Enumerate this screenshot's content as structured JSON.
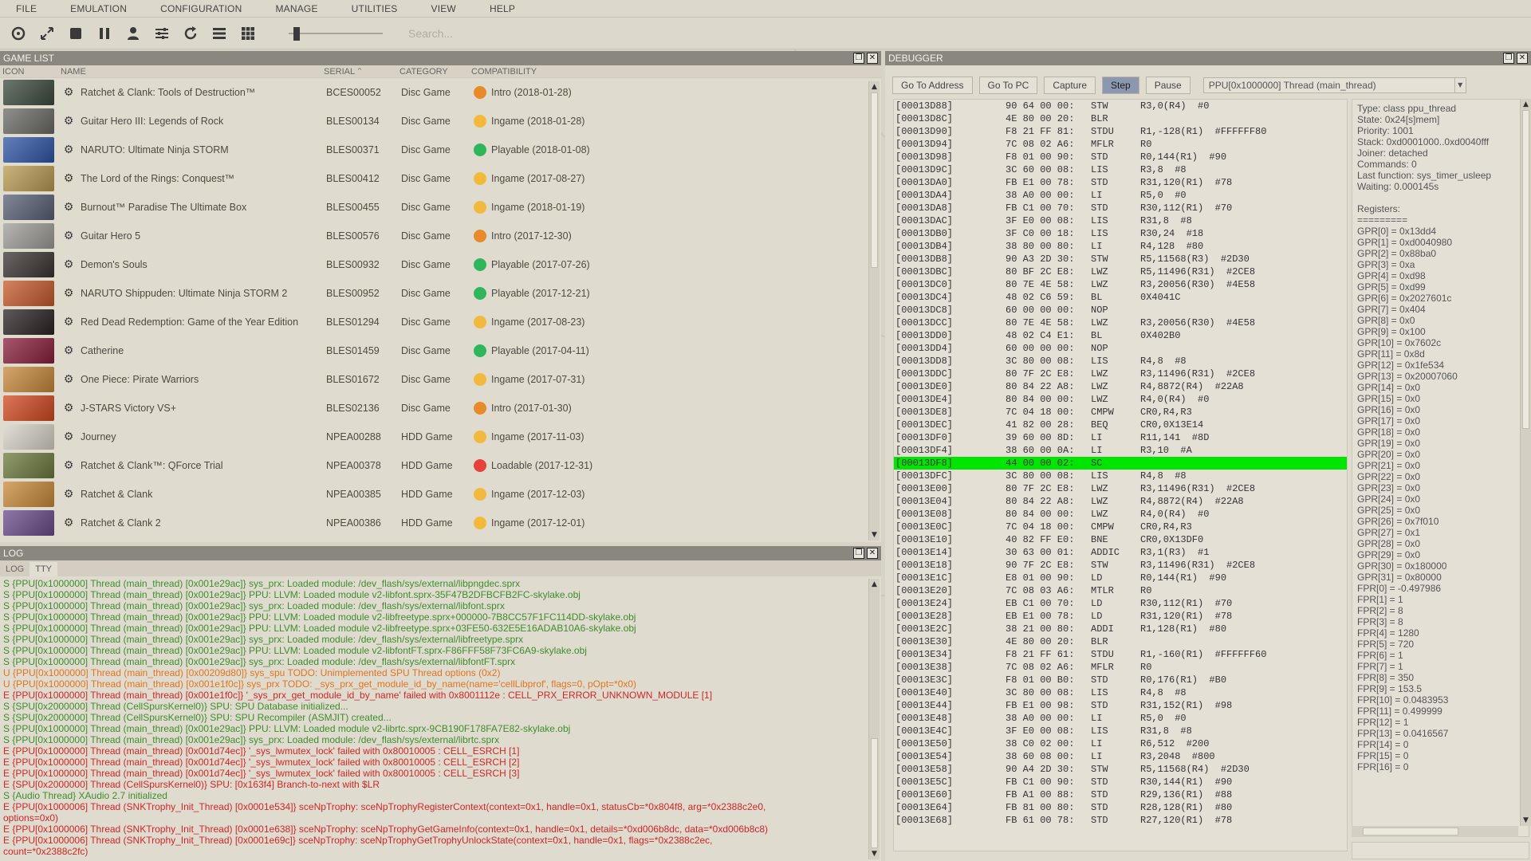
{
  "menu": [
    "FILE",
    "EMULATION",
    "CONFIGURATION",
    "MANAGE",
    "UTILITIES",
    "VIEW",
    "HELP"
  ],
  "toolbar": {
    "icons": [
      "disc-icon",
      "fullscreen-icon",
      "stop-icon",
      "pause-icon",
      "user-icon",
      "config-icon",
      "refresh-icon",
      "list-view-icon",
      "grid-view-icon"
    ],
    "search_placeholder": "Search..."
  },
  "game_list": {
    "title": "GAME LIST",
    "columns": [
      "ICON",
      "NAME",
      "SERIAL",
      "CATEGORY",
      "COMPATIBILITY"
    ],
    "rows": [
      {
        "name": "Ratchet & Clank: Tools of Destruction™",
        "serial": "BCES00052",
        "category": "Disc Game",
        "compat": "Intro (2018-01-28)",
        "color": "#e98a2a",
        "cover": "#3b4a3e"
      },
      {
        "name": "Guitar Hero III: Legends of Rock",
        "serial": "BLES00134",
        "category": "Disc Game",
        "compat": "Ingame (2018-01-28)",
        "color": "#f3b93a",
        "cover": "#6a6a66"
      },
      {
        "name": "NARUTO: Ultimate Ninja STORM",
        "serial": "BLES00371",
        "category": "Disc Game",
        "compat": "Playable (2018-01-08)",
        "color": "#2fb55a",
        "cover": "#2f56a6"
      },
      {
        "name": "The Lord of the Rings: Conquest™",
        "serial": "BLES00412",
        "category": "Disc Game",
        "compat": "Ingame (2017-08-27)",
        "color": "#f3b93a",
        "cover": "#b99a52"
      },
      {
        "name": "Burnout™ Paradise The Ultimate Box",
        "serial": "BLES00455",
        "category": "Disc Game",
        "compat": "Ingame (2018-01-19)",
        "color": "#f3b93a",
        "cover": "#586074"
      },
      {
        "name": "Guitar Hero 5",
        "serial": "BLES00576",
        "category": "Disc Game",
        "compat": "Intro (2017-12-30)",
        "color": "#e98a2a",
        "cover": "#9e9d98"
      },
      {
        "name": "Demon's Souls",
        "serial": "BLES00932",
        "category": "Disc Game",
        "compat": "Playable (2017-07-26)",
        "color": "#2fb55a",
        "cover": "#3a3430"
      },
      {
        "name": "NARUTO Shippuden: Ultimate Ninja STORM 2",
        "serial": "BLES00952",
        "category": "Disc Game",
        "compat": "Playable (2017-12-21)",
        "color": "#2fb55a",
        "cover": "#c45a2a"
      },
      {
        "name": "Red Dead Redemption: Game of the Year Edition",
        "serial": "BLES01294",
        "category": "Disc Game",
        "compat": "Ingame (2017-08-23)",
        "color": "#f3b93a",
        "cover": "#2a2222"
      },
      {
        "name": "Catherine",
        "serial": "BLES01459",
        "category": "Disc Game",
        "compat": "Playable (2017-04-11)",
        "color": "#2fb55a",
        "cover": "#8a1f3a"
      },
      {
        "name": "One Piece: Pirate Warriors",
        "serial": "BLES01672",
        "category": "Disc Game",
        "compat": "Ingame (2017-07-31)",
        "color": "#f3b93a",
        "cover": "#c8893a"
      },
      {
        "name": "J-STARS Victory VS+",
        "serial": "BLES02136",
        "category": "Disc Game",
        "compat": "Intro (2017-01-30)",
        "color": "#e98a2a",
        "cover": "#d04a20"
      },
      {
        "name": "Journey",
        "serial": "NPEA00288",
        "category": "HDD Game",
        "compat": "Ingame (2017-11-03)",
        "color": "#f3b93a",
        "cover": "#d8d4c8"
      },
      {
        "name": "Ratchet & Clank™: QForce Trial",
        "serial": "NPEA00378",
        "category": "HDD Game",
        "compat": "Loadable (2017-12-31)",
        "color": "#e5433a",
        "cover": "#6c7a3c"
      },
      {
        "name": "Ratchet & Clank",
        "serial": "NPEA00385",
        "category": "HDD Game",
        "compat": "Ingame (2017-12-03)",
        "color": "#f3b93a",
        "cover": "#c88a3a"
      },
      {
        "name": "Ratchet & Clank 2",
        "serial": "NPEA00386",
        "category": "HDD Game",
        "compat": "Ingame (2017-12-01)",
        "color": "#f3b93a",
        "cover": "#6a4a8a"
      }
    ]
  },
  "log": {
    "title": "LOG",
    "tabs": [
      "LOG",
      "TTY"
    ],
    "lines": [
      {
        "t": "S {PPU[0x1000000] Thread (main_thread) [0x001e29ac]} sys_prx: Loaded module: /dev_flash/sys/external/libpngdec.sprx",
        "c": "green"
      },
      {
        "t": "S {PPU[0x1000000] Thread (main_thread) [0x001e29ac]} PPU: LLVM: Loaded module v2-libfont.sprx-35F47B2DFBCFB2FC-skylake.obj",
        "c": "green"
      },
      {
        "t": "S {PPU[0x1000000] Thread (main_thread) [0x001e29ac]} sys_prx: Loaded module: /dev_flash/sys/external/libfont.sprx",
        "c": "green"
      },
      {
        "t": "S {PPU[0x1000000] Thread (main_thread) [0x001e29ac]} PPU: LLVM: Loaded module v2-libfreetype.sprx+000000-7B8CC57F1FC114DD-skylake.obj",
        "c": "green"
      },
      {
        "t": "S {PPU[0x1000000] Thread (main_thread) [0x001e29ac]} PPU: LLVM: Loaded module v2-libfreetype.sprx+03FE50-632E5E16ADAB10A6-skylake.obj",
        "c": "green"
      },
      {
        "t": "S {PPU[0x1000000] Thread (main_thread) [0x001e29ac]} sys_prx: Loaded module: /dev_flash/sys/external/libfreetype.sprx",
        "c": "green"
      },
      {
        "t": "S {PPU[0x1000000] Thread (main_thread) [0x001e29ac]} PPU: LLVM: Loaded module v2-libfontFT.sprx-F86FFF58F73FC6A9-skylake.obj",
        "c": "green"
      },
      {
        "t": "S {PPU[0x1000000] Thread (main_thread) [0x001e29ac]} sys_prx: Loaded module: /dev_flash/sys/external/libfontFT.sprx",
        "c": "green"
      },
      {
        "t": "U {PPU[0x1000000] Thread (main_thread) [0x00209d80]} sys_spu TODO: Unimplemented SPU Thread options (0x2)",
        "c": "orange"
      },
      {
        "t": "U {PPU[0x1000000] Thread (main_thread) [0x001e1f0c]} sys_prx TODO: _sys_prx_get_module_id_by_name(name='cellLibprof', flags=0, pOpt=*0x0)",
        "c": "orange"
      },
      {
        "t": "E {PPU[0x1000000] Thread (main_thread) [0x001e1f0c]} '_sys_prx_get_module_id_by_name' failed with 0x8001112e : CELL_PRX_ERROR_UNKNOWN_MODULE [1]",
        "c": "red"
      },
      {
        "t": "S {SPU[0x2000000] Thread (CellSpursKernel0)} SPU: SPU Database initialized...",
        "c": "green"
      },
      {
        "t": "S {SPU[0x2000000] Thread (CellSpursKernel0)} SPU: SPU Recompiler (ASMJIT) created...",
        "c": "green"
      },
      {
        "t": "S {PPU[0x1000000] Thread (main_thread) [0x001e29ac]} PPU: LLVM: Loaded module v2-librtc.sprx-9CB190F178FA7E82-skylake.obj",
        "c": "green"
      },
      {
        "t": "S {PPU[0x1000000] Thread (main_thread) [0x001e29ac]} sys_prx: Loaded module: /dev_flash/sys/external/librtc.sprx",
        "c": "green"
      },
      {
        "t": "E {PPU[0x1000000] Thread (main_thread) [0x001d74ec]} '_sys_lwmutex_lock' failed with 0x80010005 : CELL_ESRCH [1]",
        "c": "red"
      },
      {
        "t": "E {PPU[0x1000000] Thread (main_thread) [0x001d74ec]} '_sys_lwmutex_lock' failed with 0x80010005 : CELL_ESRCH [2]",
        "c": "red"
      },
      {
        "t": "E {PPU[0x1000000] Thread (main_thread) [0x001d74ec]} '_sys_lwmutex_lock' failed with 0x80010005 : CELL_ESRCH [3]",
        "c": "red"
      },
      {
        "t": "E {SPU[0x2000000] Thread (CellSpursKernel0)} SPU: [0x163f4] Branch-to-next with $LR",
        "c": "red"
      },
      {
        "t": "S {Audio Thread} XAudio 2.7 initialized",
        "c": "green"
      },
      {
        "t": "E {PPU[0x1000006] Thread (SNKTrophy_Init_Thread) [0x0001e534]} sceNpTrophy: sceNpTrophyRegisterContext(context=0x1, handle=0x1, statusCb=*0x804f8, arg=*0x2388c2e0,",
        "c": "red"
      },
      {
        "t": "options=0x0)",
        "c": "red"
      },
      {
        "t": "E {PPU[0x1000006] Thread (SNKTrophy_Init_Thread) [0x0001e638]} sceNpTrophy: sceNpTrophyGetGameInfo(context=0x1, handle=0x1, details=*0xd006b8dc, data=*0xd006b8c8)",
        "c": "red"
      },
      {
        "t": "E {PPU[0x1000006] Thread (SNKTrophy_Init_Thread) [0x0001e69c]} sceNpTrophy: sceNpTrophyGetTrophyUnlockState(context=0x1, handle=0x1, flags=*0x2388c2ec,",
        "c": "red"
      },
      {
        "t": "count=*0x2388c2fc)",
        "c": "red"
      }
    ]
  },
  "debugger": {
    "title": "DEBUGGER",
    "buttons": [
      "Go To Address",
      "Go To PC",
      "Capture",
      "Step",
      "Pause"
    ],
    "active_button": "Step",
    "thread": "PPU[0x1000000] Thread (main_thread)",
    "disasm": [
      [
        "[00013D88]",
        "90 64 00 00:",
        "STW",
        "R3,0(R4)  #0"
      ],
      [
        "[00013D8C]",
        "4E 80 00 20:",
        "BLR",
        ""
      ],
      [
        "[00013D90]",
        "F8 21 FF 81:",
        "STDU",
        "R1,-128(R1)  #FFFFFF80"
      ],
      [
        "[00013D94]",
        "7C 08 02 A6:",
        "MFLR",
        "R0"
      ],
      [
        "[00013D98]",
        "F8 01 00 90:",
        "STD",
        "R0,144(R1)  #90"
      ],
      [
        "[00013D9C]",
        "3C 60 00 08:",
        "LIS",
        "R3,8  #8"
      ],
      [
        "[00013DA0]",
        "FB E1 00 78:",
        "STD",
        "R31,120(R1)  #78"
      ],
      [
        "[00013DA4]",
        "38 A0 00 00:",
        "LI",
        "R5,0  #0"
      ],
      [
        "[00013DA8]",
        "FB C1 00 70:",
        "STD",
        "R30,112(R1)  #70"
      ],
      [
        "[00013DAC]",
        "3F E0 00 08:",
        "LIS",
        "R31,8  #8"
      ],
      [
        "[00013DB0]",
        "3F C0 00 18:",
        "LIS",
        "R30,24  #18"
      ],
      [
        "[00013DB4]",
        "38 80 00 80:",
        "LI",
        "R4,128  #80"
      ],
      [
        "[00013DB8]",
        "90 A3 2D 30:",
        "STW",
        "R5,11568(R3)  #2D30"
      ],
      [
        "[00013DBC]",
        "80 BF 2C E8:",
        "LWZ",
        "R5,11496(R31)  #2CE8"
      ],
      [
        "[00013DC0]",
        "80 7E 4E 58:",
        "LWZ",
        "R3,20056(R30)  #4E58"
      ],
      [
        "[00013DC4]",
        "48 02 C6 59:",
        "BL",
        "0X4041C"
      ],
      [
        "[00013DC8]",
        "60 00 00 00:",
        "NOP",
        ""
      ],
      [
        "[00013DCC]",
        "80 7E 4E 58:",
        "LWZ",
        "R3,20056(R30)  #4E58"
      ],
      [
        "[00013DD0]",
        "48 02 C4 E1:",
        "BL",
        "0X402B0"
      ],
      [
        "[00013DD4]",
        "60 00 00 00:",
        "NOP",
        ""
      ],
      [
        "[00013DD8]",
        "3C 80 00 08:",
        "LIS",
        "R4,8  #8"
      ],
      [
        "[00013DDC]",
        "80 7F 2C E8:",
        "LWZ",
        "R3,11496(R31)  #2CE8"
      ],
      [
        "[00013DE0]",
        "80 84 22 A8:",
        "LWZ",
        "R4,8872(R4)  #22A8"
      ],
      [
        "[00013DE4]",
        "80 84 00 00:",
        "LWZ",
        "R4,0(R4)  #0"
      ],
      [
        "[00013DE8]",
        "7C 04 18 00:",
        "CMPW",
        "CR0,R4,R3"
      ],
      [
        "[00013DEC]",
        "41 82 00 28:",
        "BEQ",
        "CR0,0X13E14"
      ],
      [
        "[00013DF0]",
        "39 60 00 8D:",
        "LI",
        "R11,141  #8D"
      ],
      [
        "[00013DF4]",
        "38 60 00 0A:",
        "LI",
        "R3,10  #A"
      ],
      [
        "[00013DF8]",
        "44 00 00 02:",
        "SC",
        ""
      ],
      [
        "[00013DFC]",
        "3C 80 00 08:",
        "LIS",
        "R4,8  #8"
      ],
      [
        "[00013E00]",
        "80 7F 2C E8:",
        "LWZ",
        "R3,11496(R31)  #2CE8"
      ],
      [
        "[00013E04]",
        "80 84 22 A8:",
        "LWZ",
        "R4,8872(R4)  #22A8"
      ],
      [
        "[00013E08]",
        "80 84 00 00:",
        "LWZ",
        "R4,0(R4)  #0"
      ],
      [
        "[00013E0C]",
        "7C 04 18 00:",
        "CMPW",
        "CR0,R4,R3"
      ],
      [
        "[00013E10]",
        "40 82 FF E0:",
        "BNE",
        "CR0,0X13DF0"
      ],
      [
        "[00013E14]",
        "30 63 00 01:",
        "ADDIC",
        "R3,1(R3)  #1"
      ],
      [
        "[00013E18]",
        "90 7F 2C E8:",
        "STW",
        "R3,11496(R31)  #2CE8"
      ],
      [
        "[00013E1C]",
        "E8 01 00 90:",
        "LD",
        "R0,144(R1)  #90"
      ],
      [
        "[00013E20]",
        "7C 08 03 A6:",
        "MTLR",
        "R0"
      ],
      [
        "[00013E24]",
        "EB C1 00 70:",
        "LD",
        "R30,112(R1)  #70"
      ],
      [
        "[00013E28]",
        "EB E1 00 78:",
        "LD",
        "R31,120(R1)  #78"
      ],
      [
        "[00013E2C]",
        "38 21 00 80:",
        "ADDI",
        "R1,128(R1)  #80"
      ],
      [
        "[00013E30]",
        "4E 80 00 20:",
        "BLR",
        ""
      ],
      [
        "[00013E34]",
        "F8 21 FF 61:",
        "STDU",
        "R1,-160(R1)  #FFFFFF60"
      ],
      [
        "[00013E38]",
        "7C 08 02 A6:",
        "MFLR",
        "R0"
      ],
      [
        "[00013E3C]",
        "F8 01 00 B0:",
        "STD",
        "R0,176(R1)  #B0"
      ],
      [
        "[00013E40]",
        "3C 80 00 08:",
        "LIS",
        "R4,8  #8"
      ],
      [
        "[00013E44]",
        "FB E1 00 98:",
        "STD",
        "R31,152(R1)  #98"
      ],
      [
        "[00013E48]",
        "38 A0 00 00:",
        "LI",
        "R5,0  #0"
      ],
      [
        "[00013E4C]",
        "3F E0 00 08:",
        "LIS",
        "R31,8  #8"
      ],
      [
        "[00013E50]",
        "38 C0 02 00:",
        "LI",
        "R6,512  #200"
      ],
      [
        "[00013E54]",
        "38 60 08 00:",
        "LI",
        "R3,2048  #800"
      ],
      [
        "[00013E58]",
        "90 A4 2D 30:",
        "STW",
        "R5,11568(R4)  #2D30"
      ],
      [
        "[00013E5C]",
        "FB C1 00 90:",
        "STD",
        "R30,144(R1)  #90"
      ],
      [
        "[00013E60]",
        "FB A1 00 88:",
        "STD",
        "R29,136(R1)  #88"
      ],
      [
        "[00013E64]",
        "FB 81 00 80:",
        "STD",
        "R28,128(R1)  #80"
      ],
      [
        "[00013E68]",
        "FB 61 00 78:",
        "STD",
        "R27,120(R1)  #78"
      ]
    ],
    "highlight_address": "[00013DF8]",
    "registers": [
      "Type: class ppu_thread",
      "State: 0x24[s]mem]",
      "Priority: 1001",
      "Stack: 0xd0001000..0xd0040fff",
      "Joiner: detached",
      "Commands: 0",
      "Last function: sys_timer_usleep",
      "Waiting: 0.000145s",
      "",
      "Registers:",
      "=========",
      "GPR[0] = 0x13dd4",
      "GPR[1] = 0xd0040980",
      "GPR[2] = 0x88ba0",
      "GPR[3] = 0xa",
      "GPR[4] = 0xd98",
      "GPR[5] = 0xd99",
      "GPR[6] = 0x2027601c",
      "GPR[7] = 0x404",
      "GPR[8] = 0x0",
      "GPR[9] = 0x100",
      "GPR[10] = 0x7602c",
      "GPR[11] = 0x8d",
      "GPR[12] = 0x1fe534",
      "GPR[13] = 0x20007060",
      "GPR[14] = 0x0",
      "GPR[15] = 0x0",
      "GPR[16] = 0x0",
      "GPR[17] = 0x0",
      "GPR[18] = 0x0",
      "GPR[19] = 0x0",
      "GPR[20] = 0x0",
      "GPR[21] = 0x0",
      "GPR[22] = 0x0",
      "GPR[23] = 0x0",
      "GPR[24] = 0x0",
      "GPR[25] = 0x0",
      "GPR[26] = 0x7f010",
      "GPR[27] = 0x1",
      "GPR[28] = 0x0",
      "GPR[29] = 0x0",
      "GPR[30] = 0x180000",
      "GPR[31] = 0x80000",
      "FPR[0] = -0.497986",
      "FPR[1] = 1",
      "FPR[2] = 8",
      "FPR[3] = 8",
      "FPR[4] = 1280",
      "FPR[5] = 720",
      "FPR[6] = 1",
      "FPR[7] = 1",
      "FPR[8] = 350",
      "FPR[9] = 153.5",
      "FPR[10] = 0.0483953",
      "FPR[11] = 0.499999",
      "FPR[12] = 1",
      "FPR[13] = 0.0416567",
      "FPR[14] = 0",
      "FPR[15] = 0",
      "FPR[16] = 0"
    ]
  }
}
